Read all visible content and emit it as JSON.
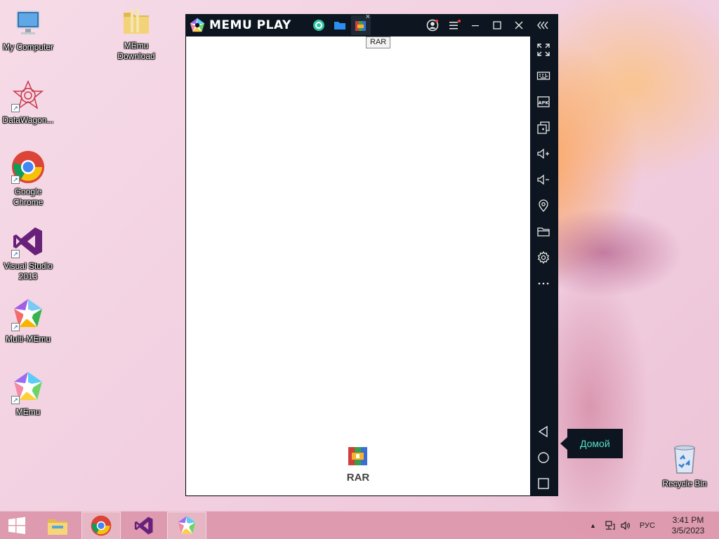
{
  "desktop": {
    "icons": [
      {
        "label": "My Computer",
        "name": "my-computer"
      },
      {
        "label": "MEmu Download",
        "name": "memu-download"
      },
      {
        "label": "DataWagon...",
        "name": "datawagon"
      },
      {
        "label": "Google Chrome",
        "name": "google-chrome"
      },
      {
        "label": "Visual Studio 2013",
        "name": "visual-studio-2013"
      },
      {
        "label": "Multi-MEmu",
        "name": "multi-memu"
      },
      {
        "label": "MEmu",
        "name": "memu"
      },
      {
        "label": "Recycle Bin",
        "name": "recycle-bin"
      }
    ]
  },
  "emulator": {
    "title": "MEMU PLAY",
    "tabs": [
      {
        "name": "tab-app-1",
        "icon": "green-circle-app-icon"
      },
      {
        "name": "tab-files",
        "icon": "folder-icon"
      },
      {
        "name": "tab-rar",
        "icon": "rar-icon",
        "close_glyph": "×"
      }
    ],
    "tab_tooltip": "RAR",
    "home_app": {
      "label": "RAR",
      "icon": "rar-app-icon"
    },
    "sidebar_tooltip": "Домой",
    "sidebar_buttons": [
      "fullscreen",
      "keyboard",
      "apk",
      "multi-window",
      "volume-up",
      "volume-down",
      "location",
      "folder",
      "settings",
      "more"
    ],
    "nav_buttons": [
      "back",
      "home",
      "recents"
    ],
    "apk_text": "APK"
  },
  "taskbar": {
    "pinned": [
      "windows-start",
      "file-explorer",
      "chrome",
      "visual-studio",
      "memu"
    ],
    "language": "РУС",
    "time": "3:41 PM",
    "date": "3/5/2023",
    "tray_arrow": "▲"
  },
  "colors": {
    "accent": "#56e0c8",
    "titlebar": "#0d1620"
  }
}
